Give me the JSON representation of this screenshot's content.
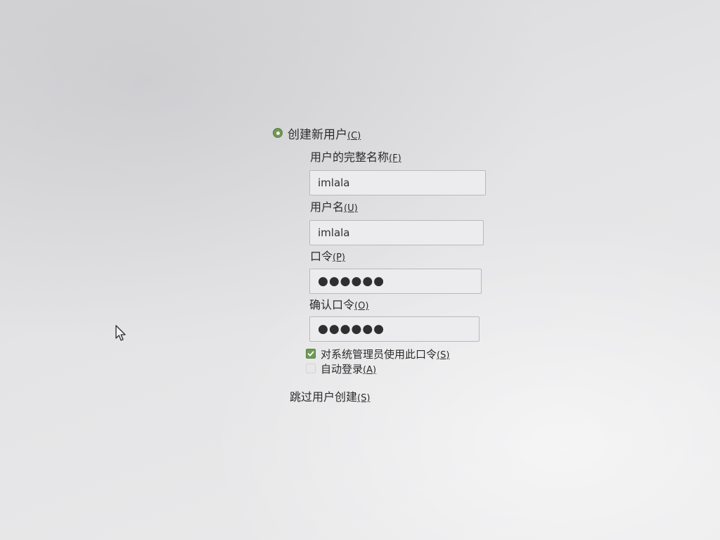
{
  "create_user": {
    "option_label": "创建新用户",
    "option_mnemonic": "(C)",
    "selected": true,
    "full_name": {
      "label": "用户的完整名称",
      "mnemonic": "(F)",
      "value": "imlala"
    },
    "username": {
      "label": "用户名",
      "mnemonic": "(U)",
      "value": "imlala"
    },
    "password": {
      "label": "口令",
      "mnemonic": "(P)",
      "masked_value": "●●●●●●"
    },
    "confirm_password": {
      "label": "确认口令",
      "mnemonic": "(O)",
      "masked_value": "●●●●●●"
    },
    "use_for_admin": {
      "label": "对系统管理员使用此口令",
      "mnemonic": "(S)",
      "checked": true
    },
    "auto_login": {
      "label": "自动登录",
      "mnemonic": "(A)",
      "checked": false
    }
  },
  "skip_user": {
    "label": "跳过用户创建",
    "mnemonic": "(S)"
  },
  "colors": {
    "accent_green": "#6e9a52",
    "background": "#e4e4e6"
  },
  "icons": {
    "cursor": "mouse-pointer-icon",
    "check": "checkmark-icon"
  }
}
